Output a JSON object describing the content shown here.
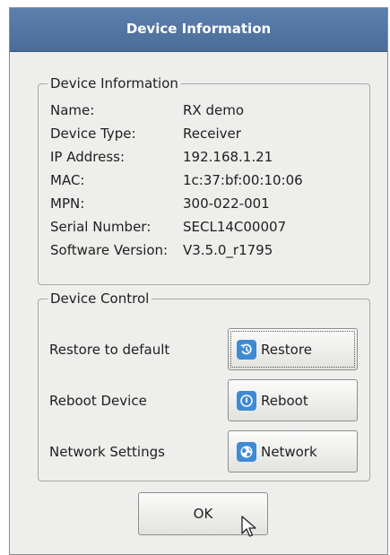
{
  "window": {
    "title": "Device Information"
  },
  "info": {
    "group_title": "Device Information",
    "rows": [
      {
        "label": "Name:",
        "value": "RX demo"
      },
      {
        "label": "Device Type:",
        "value": "Receiver"
      },
      {
        "label": "IP Address:",
        "value": "192.168.1.21"
      },
      {
        "label": "MAC:",
        "value": "1c:37:bf:00:10:06"
      },
      {
        "label": "MPN:",
        "value": "300-022-001"
      },
      {
        "label": "Serial Number:",
        "value": "SECL14C00007"
      },
      {
        "label": "Software Version:",
        "value": "V3.5.0_r1795"
      }
    ]
  },
  "control": {
    "group_title": "Device Control",
    "items": [
      {
        "label": "Restore to default",
        "button": "Restore",
        "icon": "restore-icon"
      },
      {
        "label": "Reboot Device",
        "button": "Reboot",
        "icon": "power-icon"
      },
      {
        "label": "Network Settings",
        "button": "Network",
        "icon": "network-icon"
      }
    ]
  },
  "footer": {
    "ok_label": "OK"
  },
  "colors": {
    "titlebar": "#4f73a3",
    "icon_blue": "#3e8bd4",
    "dialog_bg": "#eeeeec"
  }
}
